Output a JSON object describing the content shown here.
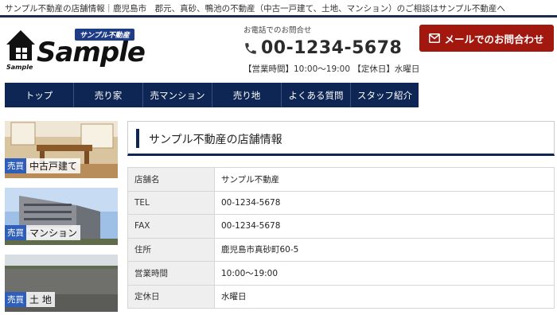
{
  "topbar": {
    "text": "サンプル不動産の店舗情報｜鹿児島市　郡元、真砂、鴨池の不動産（中古一戸建て、土地、マンション）のご相談はサンプル不動産へ"
  },
  "logo": {
    "badge": "サンプル不動産",
    "main": "Sample",
    "house_text": "Sample"
  },
  "contact": {
    "label": "お電話でのお問合せ",
    "phone": "00-1234-5678",
    "hours": "【営業時間】10:00～19:00 【定休日】水曜日"
  },
  "mail_button": {
    "label": "メールでのお問合わせ"
  },
  "nav": [
    {
      "label": "トップ"
    },
    {
      "label": "売り家"
    },
    {
      "label": "売マンション"
    },
    {
      "label": "売り地"
    },
    {
      "label": "よくある質問"
    },
    {
      "label": "スタッフ紹介"
    }
  ],
  "sidebar": [
    {
      "tag": "売買",
      "title": "中古戸建て"
    },
    {
      "tag": "売買",
      "title": "マンション"
    },
    {
      "tag": "売買",
      "title": "土 地"
    }
  ],
  "main": {
    "title": "サンプル不動産の店舗情報",
    "rows": [
      {
        "key": "店舗名",
        "value": "サンプル不動産"
      },
      {
        "key": "TEL",
        "value": "00-1234-5678"
      },
      {
        "key": "FAX",
        "value": "00-1234-5678"
      },
      {
        "key": "住所",
        "value": "鹿児島市真砂町60-5"
      },
      {
        "key": "営業時間",
        "value": "10:00～19:00"
      },
      {
        "key": "定休日",
        "value": "水曜日"
      }
    ]
  },
  "colors": {
    "navy": "#0e2653",
    "red": "#a2180f",
    "tag_blue": "#2f5fb8"
  }
}
